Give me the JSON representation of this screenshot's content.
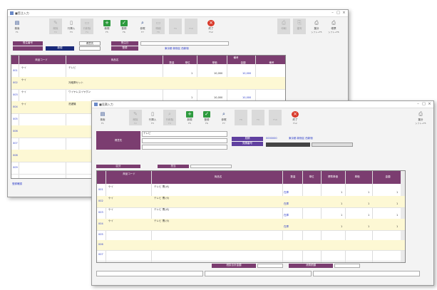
{
  "back_window": {
    "title": "■受注入力",
    "toolbar": [
      {
        "label": "検索",
        "key": "F1"
      },
      {
        "label": "削除",
        "key": "F2"
      },
      {
        "label": "行挿入",
        "key": "F3"
      },
      {
        "label": "行削除",
        "key": "F4"
      },
      {
        "label": "新規",
        "key": "F5"
      },
      {
        "label": "登録",
        "key": "F6"
      },
      {
        "label": "参照",
        "key": "F7"
      },
      {
        "label": "明細",
        "key": "F8"
      },
      {
        "label": "",
        "key": "F9"
      },
      {
        "label": "",
        "key": "F10"
      },
      {
        "label": "終了",
        "key": "F12"
      }
    ],
    "right_buttons": [
      {
        "label": "印刷",
        "key": ""
      },
      {
        "label": "複写",
        "key": ""
      },
      {
        "label": "集計",
        "key": "シフト+F5"
      },
      {
        "label": "帳票",
        "key": "シフト+F6"
      }
    ],
    "header": {
      "label1": "受注番号",
      "label2": "得意先",
      "label3": "受注日",
      "value1": "新規",
      "value2": "",
      "value3": "登録",
      "field": "",
      "link": "東京都 新宿区 西新宿"
    },
    "grid_head": [
      "商品コード",
      "商品名",
      "数量",
      "単位",
      "単価",
      "金額",
      "備考"
    ],
    "grid_top": "備考",
    "rows": [
      {
        "no": "001",
        "code": "ケイ",
        "name": "テレビ",
        "qty": "1",
        "price": "10,000",
        "amt": "10,000"
      },
      {
        "no": "002",
        "code": "ケイ",
        "name": "冷蔵庫セット",
        "qty": "",
        "price": "",
        "amt": ""
      },
      {
        "no": "003",
        "code": "ケイ",
        "name": "ワイヤレスイヤホン",
        "qty": "1",
        "price": "10,000",
        "amt": "10,000"
      },
      {
        "no": "004",
        "code": "ケイ",
        "name": "洗濯機",
        "qty": "",
        "price": "",
        "amt": ""
      },
      {
        "no": "005",
        "code": "",
        "name": "",
        "qty": "",
        "price": "",
        "amt": ""
      },
      {
        "no": "006",
        "code": "",
        "name": "",
        "qty": "",
        "price": "",
        "amt": ""
      },
      {
        "no": "007",
        "code": "",
        "name": "",
        "qty": "",
        "price": "",
        "amt": ""
      },
      {
        "no": "008",
        "code": "",
        "name": "",
        "qty": "",
        "price": "",
        "amt": ""
      },
      {
        "no": "009",
        "code": "",
        "name": "",
        "qty": "",
        "price": "",
        "amt": ""
      }
    ],
    "status": "登録確認"
  },
  "front_window": {
    "title": "■見積入力",
    "toolbar": [
      {
        "label": "検索",
        "key": "F1"
      },
      {
        "label": "削除",
        "key": "F2"
      },
      {
        "label": "行挿入",
        "key": "F3"
      },
      {
        "label": "行削除",
        "key": "F4"
      },
      {
        "label": "新規",
        "key": "F5"
      },
      {
        "label": "登録",
        "key": "F6"
      },
      {
        "label": "参照",
        "key": "F7"
      },
      {
        "label": "",
        "key": "F8"
      },
      {
        "label": "",
        "key": "F9"
      },
      {
        "label": "",
        "key": "F10"
      },
      {
        "label": "終了",
        "key": "F12"
      }
    ],
    "right_buttons": [
      {
        "label": "集計",
        "key": "シフト+F5"
      }
    ],
    "header": {
      "label": "得意先",
      "field_main": "テレビ",
      "tag1": "見積",
      "tag2": "見積番号",
      "code": "0000000",
      "link": "東京都 新宿区 西新宿",
      "bar1": "",
      "bar2": ""
    },
    "subhead": [
      "区分",
      "担当"
    ],
    "grid_head": [
      "商品コード",
      "商品名",
      "数量",
      "単位",
      "標準単価",
      "単価",
      "金額"
    ],
    "rows": [
      {
        "no": "001",
        "code": "ケイ",
        "name": "テレビ 黒(大)",
        "note": "在庫",
        "qty": "1",
        "price": "1",
        "amt": "1"
      },
      {
        "no": "002",
        "code": "ケイ",
        "name": "テレビ 黒(小)",
        "note": "在庫",
        "qty": "1",
        "price": "1",
        "amt": "1"
      },
      {
        "no": "003",
        "code": "ケイ",
        "name": "テレビ 黒(大)",
        "note": "在庫",
        "qty": "1",
        "price": "1",
        "amt": "1"
      },
      {
        "no": "004",
        "code": "ケイ",
        "name": "テレビ 黒(小)",
        "note": "在庫",
        "qty": "1",
        "price": "1",
        "amt": "1"
      },
      {
        "no": "005",
        "code": "",
        "name": "",
        "note": "",
        "qty": "",
        "price": "",
        "amt": ""
      },
      {
        "no": "006",
        "code": "",
        "name": "",
        "note": "",
        "qty": "",
        "price": "",
        "amt": ""
      },
      {
        "no": "007",
        "code": "",
        "name": "",
        "note": "",
        "qty": "",
        "price": "",
        "amt": ""
      }
    ],
    "footer_labels": [
      "税抜合計金額",
      "消費税額"
    ],
    "footer_values": [
      "",
      ""
    ]
  }
}
